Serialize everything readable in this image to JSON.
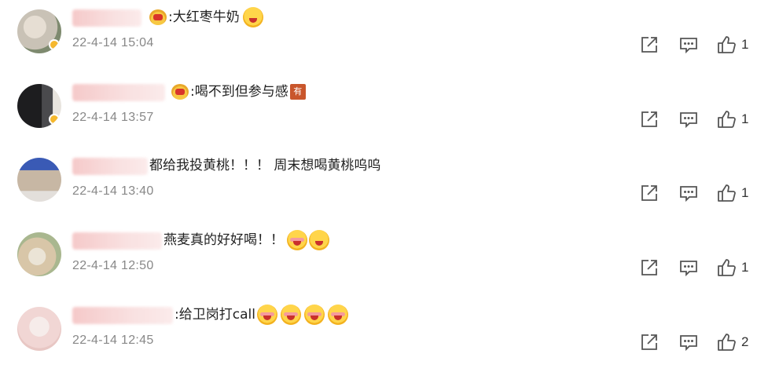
{
  "comments": [
    {
      "text": ":大红枣牛奶",
      "time": "22-4-14 15:04",
      "likes": "1",
      "has_vip": true,
      "emojis": [
        "laugh-cry-emoji"
      ],
      "avatar_colors": [
        "#c9c2b6",
        "#7e8a6f",
        "#e6ded3"
      ]
    },
    {
      "text": ":喝不到但参与感",
      "time": "22-4-14 13:57",
      "likes": "1",
      "has_vip": true,
      "tag": "有",
      "avatar_colors": [
        "#1d1d1f",
        "#4a4a4d",
        "#e8e4de"
      ]
    },
    {
      "text": "都给我投黄桃！！！ 周末想喝黄桃呜呜",
      "time": "22-4-14 13:40",
      "likes": "1",
      "has_vip": false,
      "avatar_colors": [
        "#3a5ab5",
        "#c7b7a4",
        "#e3dfdb"
      ]
    },
    {
      "text": "燕麦真的好好喝！！",
      "time": "22-4-14 12:50",
      "likes": "1",
      "has_vip": false,
      "emojis": [
        "flower-cheer-emoji",
        "sweat-smile-emoji"
      ],
      "avatar_colors": [
        "#a9b78f",
        "#d8c6a8",
        "#ebe4d6"
      ]
    },
    {
      "text": ":给卫岗打call",
      "time": "22-4-14 12:45",
      "likes": "2",
      "has_vip": false,
      "emojis": [
        "flower-cheer-emoji",
        "flower-cheer-emoji",
        "flower-cheer-emoji",
        "flower-cheer-emoji"
      ],
      "avatar_colors": [
        "#f1d6d4",
        "#e8c7c4",
        "#f6ecea"
      ]
    }
  ],
  "icons": {
    "share": "share-icon",
    "reply": "comment-icon",
    "like": "thumbs-up-icon"
  }
}
